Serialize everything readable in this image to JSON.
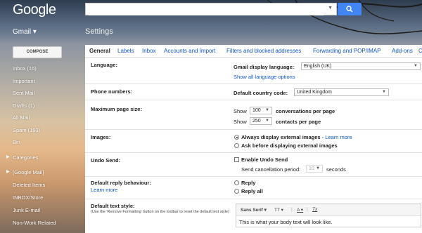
{
  "header": {
    "logo": "Google",
    "search_placeholder": "",
    "app_label": "Gmail ▾",
    "page_title": "Settings"
  },
  "sidebar": {
    "compose_label": "COMPOSE",
    "items": [
      {
        "label": "Inbox (16)"
      },
      {
        "label": "Important"
      },
      {
        "label": "Sent Mail"
      },
      {
        "label": "Drafts (1)"
      },
      {
        "label": "All Mail"
      },
      {
        "label": "Spam (193)"
      },
      {
        "label": "Bin"
      },
      {
        "label": "Categories"
      },
      {
        "label": "[Google Mail]"
      },
      {
        "label": "Deleted Items"
      },
      {
        "label": "INBOX/Store"
      },
      {
        "label": "Junk E-mail"
      },
      {
        "label": "Non-Work Related"
      }
    ]
  },
  "tabs": [
    "General",
    "Labels",
    "Inbox",
    "Accounts and Import",
    "Filters and blocked addresses",
    "Forwarding and POP/IMAP",
    "Add-ons",
    "C"
  ],
  "settings": {
    "language": {
      "label": "Language:",
      "display_label": "Gmail display language:",
      "display_value": "English (UK)",
      "show_all_link": "Show all language options"
    },
    "phone": {
      "label": "Phone numbers:",
      "country_label": "Default country code:",
      "country_value": "United Kingdom"
    },
    "page_size": {
      "label": "Maximum page size:",
      "show1": "Show",
      "conv_value": "100",
      "conv_suffix": "conversations per page",
      "show2": "Show",
      "contacts_value": "250",
      "contacts_suffix": "contacts per page"
    },
    "images": {
      "label": "Images:",
      "opt1": "Always display external images",
      "opt1_sep": " - ",
      "learn_more": "Learn more",
      "opt2": "Ask before displaying external images"
    },
    "undo_send": {
      "label": "Undo Send:",
      "enable": "Enable Undo Send",
      "period_label": "Send cancellation period:",
      "period_value": "10",
      "period_suffix": "seconds"
    },
    "reply": {
      "label": "Default reply behaviour:",
      "learn_more": "Learn more",
      "opt1": "Reply",
      "opt2": "Reply all"
    },
    "text_style": {
      "label": "Default text style:",
      "hint": "(Use the 'Remove Formatting' button on the toolbar to reset the default text style)",
      "font": "Sans Serif",
      "size_icon": "TT",
      "color_icon": "A",
      "clear_icon": "Tx",
      "preview": "This is what your body text will look like."
    }
  },
  "colors": {
    "accent": "#4285f4",
    "link": "#1155cc"
  }
}
